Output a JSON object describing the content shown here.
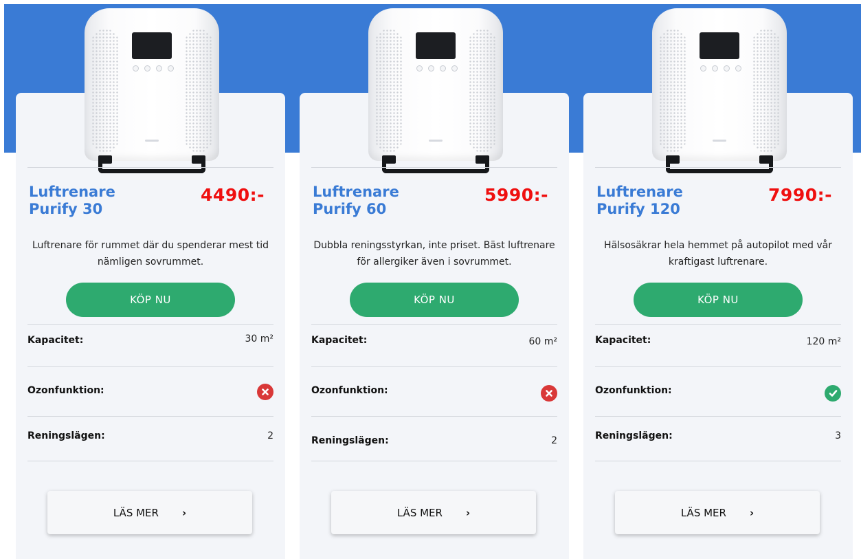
{
  "products": [
    {
      "name": "Luftrenare\nPurify 30",
      "price": "4490:-",
      "description": "Luftrenare för rummet där du spenderar mest tid nämligen sovrummet.",
      "buy_label": "KÖP NU",
      "specs": {
        "capacity_label": "Kapacitet:",
        "capacity_value": "30 m²",
        "ozone_label": "Ozonfunktion:",
        "ozone_icon": "x-circle-icon",
        "ozone_color": "#d93838",
        "modes_label": "Reningslägen:",
        "modes_value": "2"
      },
      "read_more_label": "LÄS MER",
      "read_more_icon": "chevron-right-icon"
    },
    {
      "name": "Luftrenare\nPurify 60",
      "price": "5990:-",
      "description": "Dubbla reningsstyrkan, inte priset. Bäst luftrenare för allergiker även i sovrummet.",
      "buy_label": "KÖP NU",
      "specs": {
        "capacity_label": "Kapacitet:",
        "capacity_value": "60 m²",
        "ozone_label": "Ozonfunktion:",
        "ozone_icon": "x-circle-icon",
        "ozone_color": "#d93838",
        "modes_label": "Reningslägen:",
        "modes_value": "2"
      },
      "read_more_label": "LÄS MER",
      "read_more_icon": "chevron-right-icon"
    },
    {
      "name": "Luftrenare\nPurify 120",
      "price": "7990:-",
      "description": "Hälsosäkrar hela hemmet på autopilot med vår kraftigast luftrenare.",
      "buy_label": "KÖP NU",
      "specs": {
        "capacity_label": "Kapacitet:",
        "capacity_value": "120 m²",
        "ozone_label": "Ozonfunktion:",
        "ozone_icon": "check-circle-icon",
        "ozone_color": "#2eaa6f",
        "modes_label": "Reningslägen:",
        "modes_value": "3"
      },
      "read_more_label": "LÄS MER",
      "read_more_icon": "chevron-right-icon"
    }
  ],
  "colors": {
    "hero_band": "#3a7bd5",
    "title": "#3a7bd5",
    "price": "#ef0f0f",
    "buy_button": "#2eaa6f",
    "card_bg": "#f3f5f9"
  }
}
